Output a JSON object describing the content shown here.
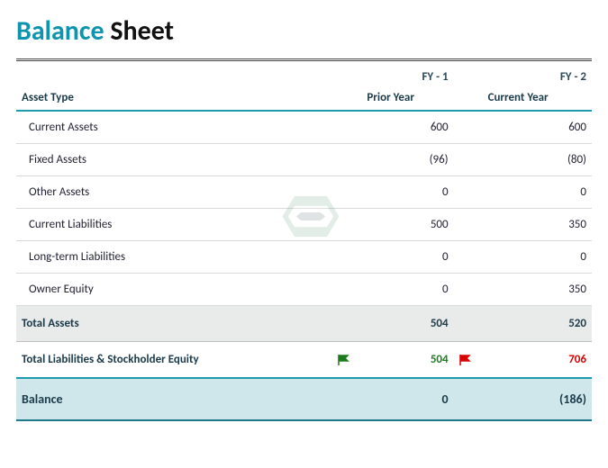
{
  "title": {
    "accent": "Balance",
    "rest": "Sheet"
  },
  "columns": {
    "fy1_code": "FY - 1",
    "fy2_code": "FY - 2",
    "fy1_label": "Prior Year",
    "fy2_label": "Current Year",
    "asset_type": "Asset Type"
  },
  "rows": [
    {
      "label": "Current Assets",
      "fy1": "600",
      "fy2": "600",
      "neg": false
    },
    {
      "label": "Fixed Assets",
      "fy1": "(96)",
      "fy2": "(80)",
      "neg": true
    },
    {
      "label": "Other Assets",
      "fy1": "0",
      "fy2": "0",
      "neg": false
    },
    {
      "label": "Current Liabilities",
      "fy1": "500",
      "fy2": "350",
      "neg": false
    },
    {
      "label": "Long-term Liabilities",
      "fy1": "0",
      "fy2": "0",
      "neg": false
    },
    {
      "label": "Owner Equity",
      "fy1": "0",
      "fy2": "350",
      "neg": false
    }
  ],
  "totals": {
    "assets_label": "Total Assets",
    "assets_fy1": "504",
    "assets_fy2": "520",
    "tlse_label": "Total Liabilities & Stockholder Equity",
    "tlse_fy1": "504",
    "tlse_fy2": "706",
    "tlse_fy1_flag": "green",
    "tlse_fy2_flag": "red",
    "balance_label": "Balance",
    "balance_fy1": "0",
    "balance_fy2": "(186)",
    "balance_fy2_neg": true
  },
  "chart_data": {
    "type": "table",
    "title": "Balance Sheet",
    "columns": [
      "Asset Type",
      "FY - 1 (Prior Year)",
      "FY - 2 (Current Year)"
    ],
    "rows": [
      [
        "Current Assets",
        600,
        600
      ],
      [
        "Fixed Assets",
        -96,
        -80
      ],
      [
        "Other Assets",
        0,
        0
      ],
      [
        "Current Liabilities",
        500,
        350
      ],
      [
        "Long-term Liabilities",
        0,
        0
      ],
      [
        "Owner Equity",
        0,
        350
      ],
      [
        "Total Assets",
        504,
        520
      ],
      [
        "Total Liabilities & Stockholder Equity",
        504,
        706
      ],
      [
        "Balance",
        0,
        -186
      ]
    ]
  }
}
